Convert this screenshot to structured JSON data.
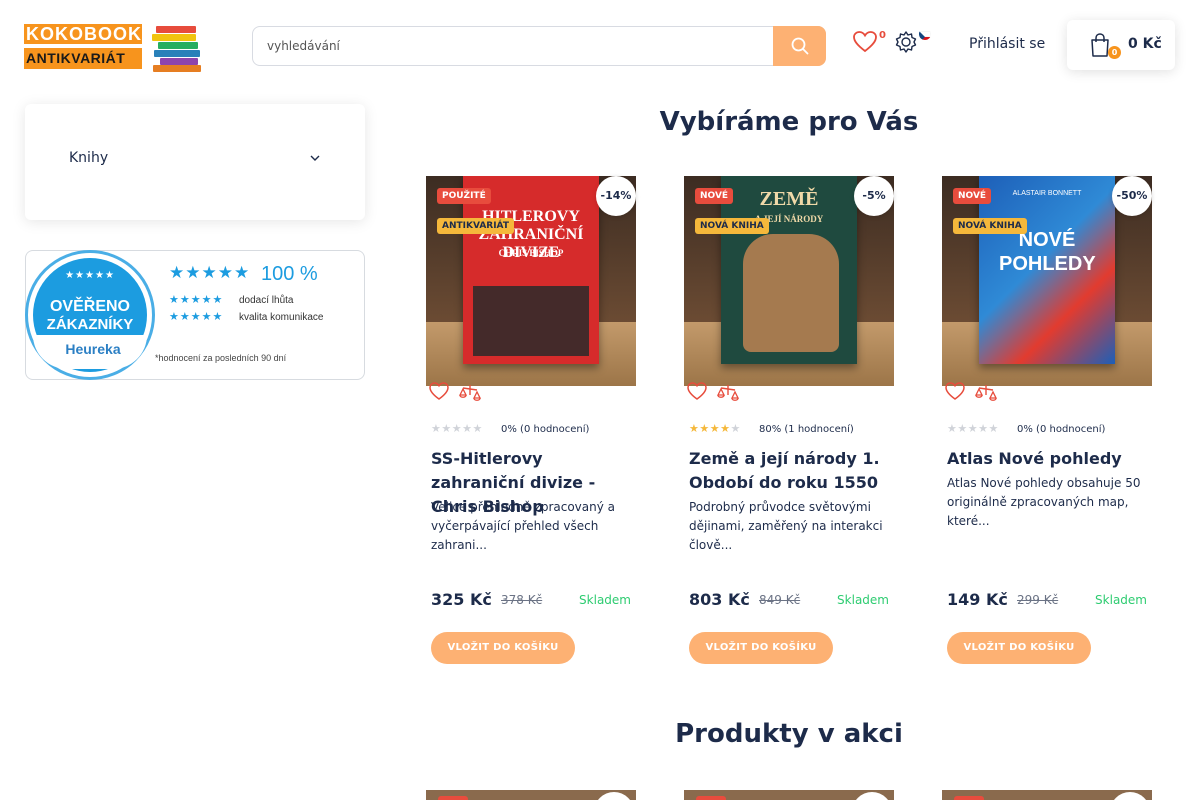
{
  "header": {
    "logo": {
      "line1": "KOKOBOOK",
      "line2": "ANTIKVARIÁT"
    },
    "search_placeholder": "vyhledávání",
    "wishlist_count": "0",
    "login_label": "Přihlásit se",
    "cart": {
      "count": "0",
      "total": "0 Kč"
    }
  },
  "sidebar": {
    "category_label": "Knihy",
    "heureka": {
      "seal_line1": "OVĚŘENO",
      "seal_line2": "ZÁKAZNÍKY",
      "brand": "Heureka",
      "percent": "100 %",
      "row1": "dodací lhůta",
      "row2": "kvalita komunikace",
      "footnote": "*hodnocení za posledních 90 dní"
    }
  },
  "sections": {
    "recommended_title": "Vybíráme pro Vás",
    "sale_title": "Produkty v akci"
  },
  "products": [
    {
      "badge1": "POUŽITÉ",
      "badge2": "ANTIKVARIÁT",
      "discount": "-14%",
      "stars_filled": 0,
      "rating": "0% (0 hodnocení)",
      "name": "SS-Hitlerovy zahraniční divize - Chris Bishop",
      "description": "Velice přehledně zpracovaný a vyčerpávající přehled všech zahrani...",
      "price": "325 Kč",
      "old_price": "378 Kč",
      "stock": "Skladem",
      "button": "VLOŽIT DO KOŠÍKU",
      "cover_title": "HITLEROVY ZAHRANIČNÍ DIVIZE",
      "cover_author": "CHRIS BISHOP",
      "cover_color": "#d62b2b"
    },
    {
      "badge1": "NOVÉ",
      "badge2": "NOVÁ KNIHA",
      "discount": "-5%",
      "stars_filled": 4,
      "rating": "80% (1 hodnocení)",
      "name": "Země a její národy 1. Období do roku 1550",
      "description": "Podrobný průvodce světovými dějinami, zaměřený na interakci člově...",
      "price": "803 Kč",
      "old_price": "849 Kč",
      "stock": "Skladem",
      "button": "VLOŽIT DO KOŠÍKU",
      "cover_title": "ZEMĚ",
      "cover_author": "A JEJÍ NÁRODY",
      "cover_color": "#1f4a3f"
    },
    {
      "badge1": "NOVÉ",
      "badge2": "NOVÁ KNIHA",
      "discount": "-50%",
      "stars_filled": 0,
      "rating": "0% (0 hodnocení)",
      "name": "Atlas Nové pohledy",
      "description": "Atlas Nové pohledy obsahuje 50 originálně zpracovaných map, které...",
      "price": "149 Kč",
      "old_price": "299 Kč",
      "stock": "Skladem",
      "button": "VLOŽIT DO KOŠÍKU",
      "cover_title": "NOVÉ POHLEDY",
      "cover_author": "ALASTAIR BONNETT",
      "cover_color": "#1d5fb8"
    }
  ]
}
